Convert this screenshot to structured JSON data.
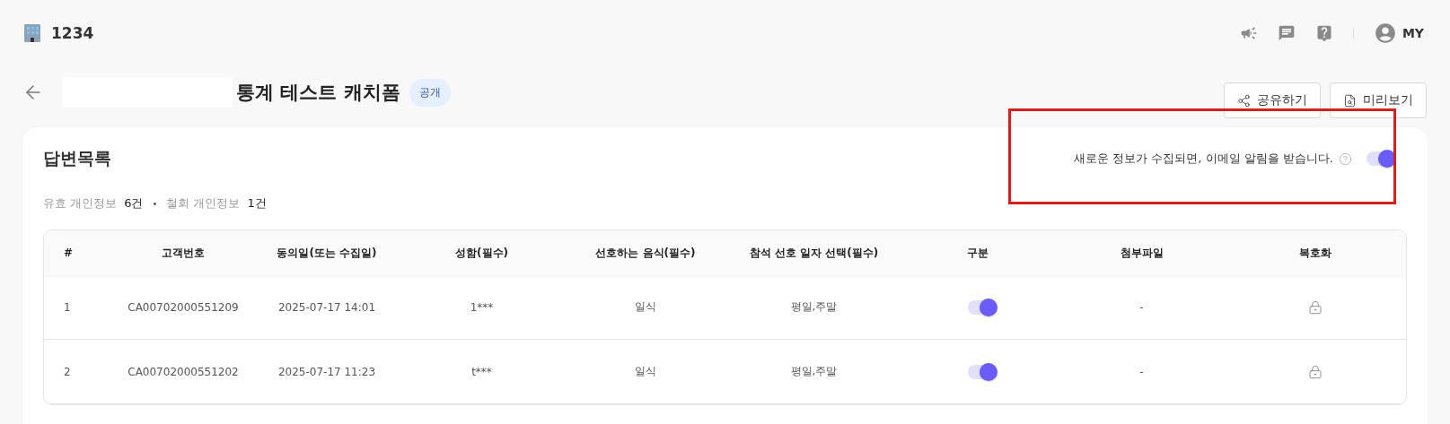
{
  "header": {
    "workspace": "1234",
    "user_label": "MY"
  },
  "title_bar": {
    "title": "통계 테스트 캐치폼",
    "badge": "공개",
    "buttons": [
      {
        "label": "공유하기",
        "kind": "share"
      },
      {
        "label": "미리보기",
        "kind": "preview"
      }
    ]
  },
  "card": {
    "title": "답변목록",
    "separator": "•",
    "stats": [
      {
        "label": "유효 개인정보",
        "value": "6건"
      },
      {
        "label": "철회 개인정보",
        "value": "1건"
      }
    ],
    "notification": {
      "text": "새로운 정보가 수집되면, 이메일 알림을 받습니다.",
      "on": true,
      "highlighted": true
    },
    "table": {
      "columns": [
        "#",
        "고객번호",
        "동의일(또는 수집일)",
        "성함(필수)",
        "선호하는 음식(필수)",
        "참석 선호 일자 선택(필수)",
        "구분",
        "첨부파일",
        "복호화"
      ],
      "rows": [
        {
          "cells": [
            "1",
            "CA00702000551209",
            "2025-07-17 14:01",
            "1***",
            "일식",
            "평일,주말"
          ],
          "active": true,
          "attachment": "-"
        },
        {
          "cells": [
            "2",
            "CA00702000551202",
            "2025-07-17 11:23",
            "t***",
            "일식",
            "평일,주말"
          ],
          "active": true,
          "attachment": "-"
        }
      ]
    }
  }
}
